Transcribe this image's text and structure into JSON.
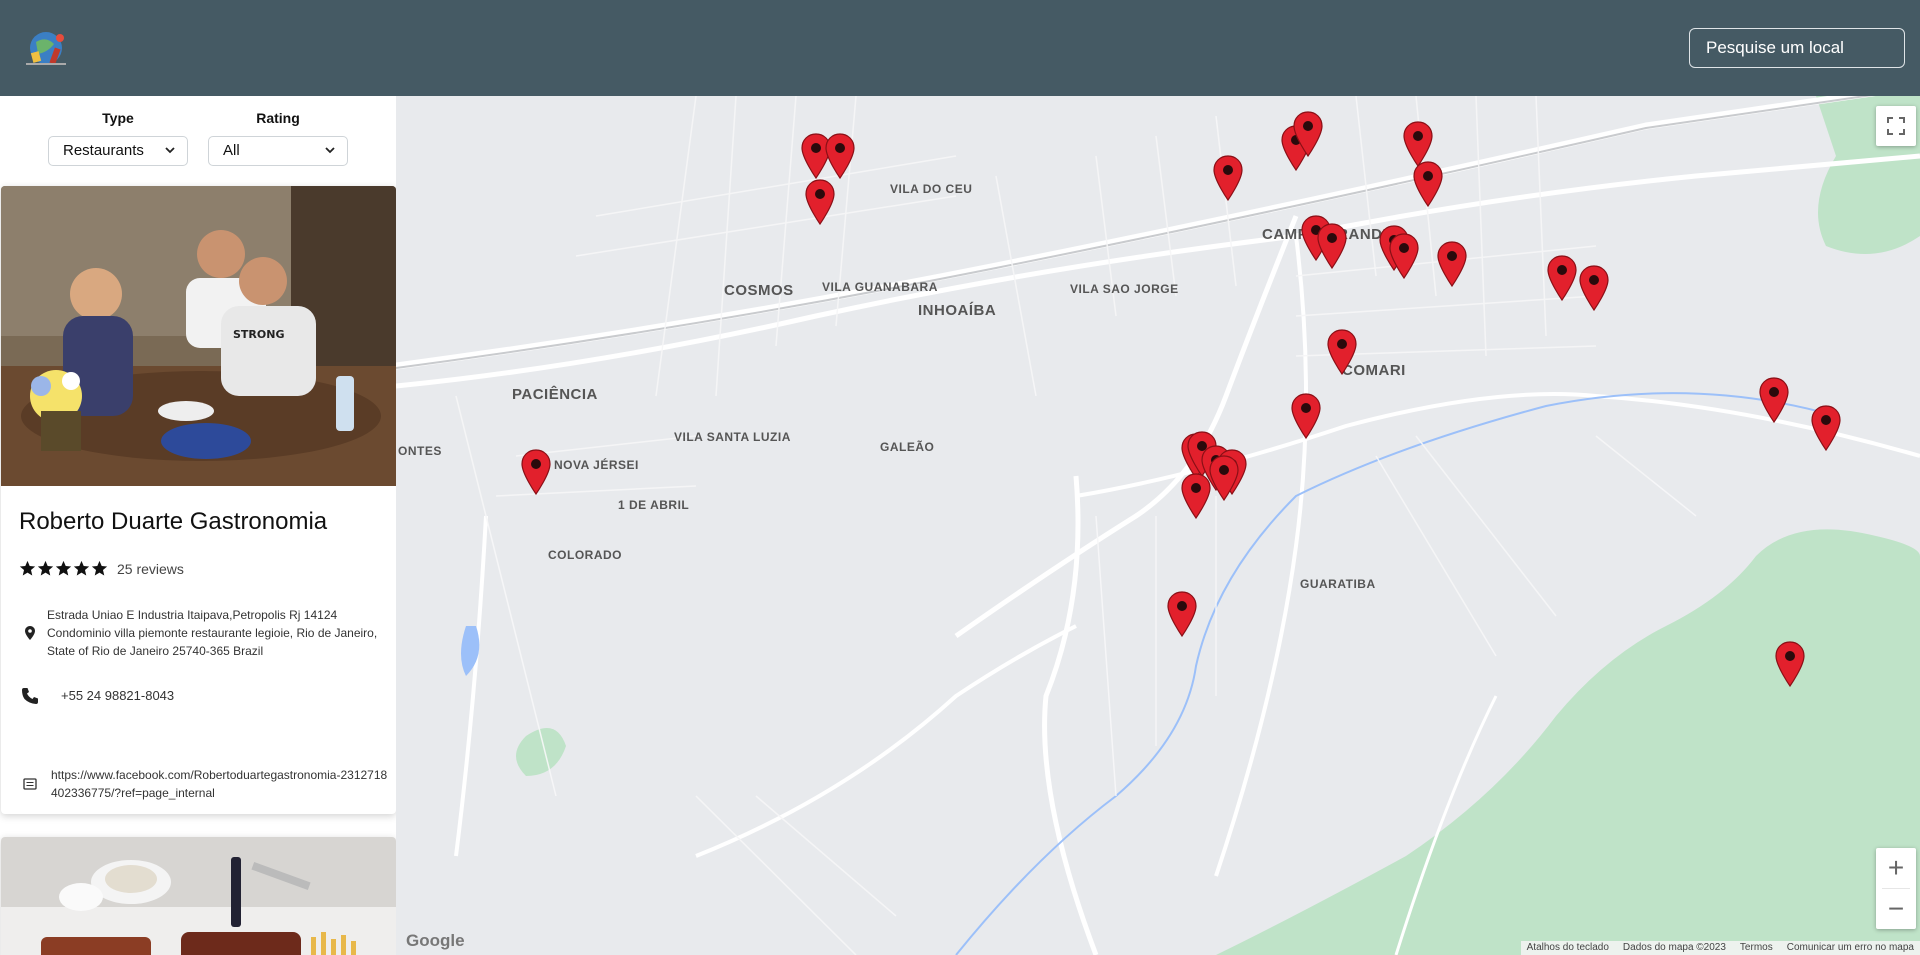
{
  "header": {
    "search_placeholder": "Pesquise um local",
    "background_color": "#455a64"
  },
  "filters": {
    "type_label": "Type",
    "type_value": "Restaurants",
    "rating_label": "Rating",
    "rating_value": "All"
  },
  "places": [
    {
      "name": "Roberto Duarte Gastronomia",
      "stars": 5,
      "reviews": "25 reviews",
      "address": "Estrada Uniao E Industria Itaipava,Petropolis Rj 14124 Condominio villa piemonte restaurante legioie, Rio de Janeiro, State of Rio de Janeiro 25740-365 Brazil",
      "phone": "+55 24 98821-8043",
      "website": "https://www.facebook.com/Robertoduartegastronomia-2312718402336775/?ref=page_internal"
    }
  ],
  "map": {
    "neighborhoods": [
      "COSMOS",
      "INHOAÍBA",
      "PACIÊNCIA",
      "CAMPO GRANDE",
      "COMARI",
      "VILA DO CEU",
      "VILA GUANABARA",
      "VILA SAO JORGE",
      "VILA SANTA LUZIA",
      "GALEÃO",
      "NOVA JÉRSEI",
      "1 DE ABRIL",
      "COLORADO",
      "GUARATIBA",
      "ONTES"
    ],
    "pin_color": "#e2202c",
    "attribution": [
      "Atalhos do teclado",
      "Dados do mapa ©2023",
      "Termos",
      "Comunicar um erro no mapa"
    ],
    "google_label": "Google",
    "zoom_in": "+",
    "zoom_out": "−"
  }
}
